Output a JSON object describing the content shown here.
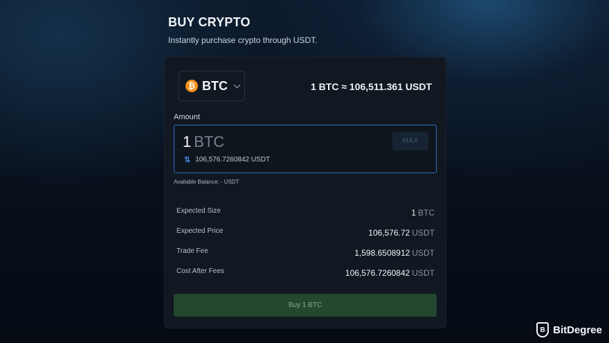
{
  "header": {
    "title": "BUY CRYPTO",
    "subtitle": "Instantly purchase crypto through USDT."
  },
  "asset": {
    "icon_glyph": "₿",
    "icon_name": "bitcoin-icon",
    "icon_color": "#f7931a",
    "name": "BTC",
    "rate": "1 BTC ≈ 106,511.361 USDT"
  },
  "amount": {
    "label": "Amount",
    "value": "1",
    "unit": "BTC",
    "max_label": "MAX",
    "swap_glyph": "⇅",
    "converted_value": "106,576.7260842",
    "converted_unit": "USDT",
    "balance": "Available Balance: - USDT"
  },
  "details": [
    {
      "label": "Expected Size",
      "value": "1",
      "unit": "BTC"
    },
    {
      "label": "Expected Price",
      "value": "106,576.72",
      "unit": "USDT"
    },
    {
      "label": "Trade Fee",
      "value": "1,598.6508912",
      "unit": "USDT"
    },
    {
      "label": "Cost After Fees",
      "value": "106,576.7260842",
      "unit": "USDT"
    }
  ],
  "buy_button": {
    "label": "Buy 1 BTC",
    "color": "#24472f"
  },
  "accent_color": "#2e6fc6",
  "brand": {
    "glyph": "B",
    "name": "BitDegree"
  }
}
